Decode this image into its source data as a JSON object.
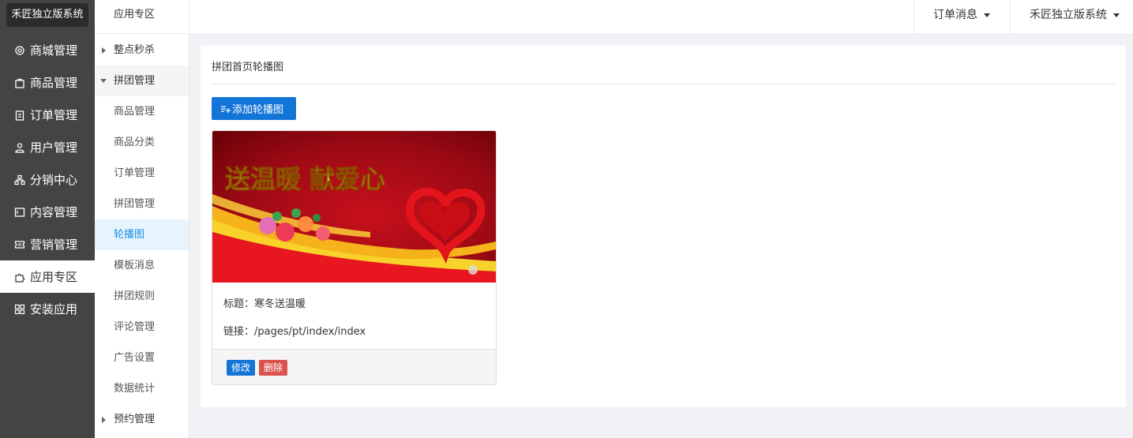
{
  "sidebar": {
    "logo": "禾匠独立版系统",
    "items": [
      {
        "label": "商城管理",
        "icon": "gear-icon"
      },
      {
        "label": "商品管理",
        "icon": "bag-icon"
      },
      {
        "label": "订单管理",
        "icon": "clipboard-icon"
      },
      {
        "label": "用户管理",
        "icon": "user-icon"
      },
      {
        "label": "分销中心",
        "icon": "network-icon"
      },
      {
        "label": "内容管理",
        "icon": "article-icon"
      },
      {
        "label": "营销管理",
        "icon": "ticket-icon"
      },
      {
        "label": "应用专区",
        "icon": "puzzle-icon",
        "active": true
      },
      {
        "label": "安装应用",
        "icon": "apps-icon"
      }
    ]
  },
  "subnav": {
    "header": "应用专区",
    "items": [
      {
        "label": "整点秒杀"
      },
      {
        "label": "拼团管理"
      },
      {
        "label": "商品管理"
      },
      {
        "label": "商品分类"
      },
      {
        "label": "订单管理"
      },
      {
        "label": "拼团管理"
      },
      {
        "label": "轮播图"
      },
      {
        "label": "模板消息"
      },
      {
        "label": "拼团规则"
      },
      {
        "label": "评论管理"
      },
      {
        "label": "广告设置"
      },
      {
        "label": "数据统计"
      },
      {
        "label": "预约管理"
      }
    ]
  },
  "topbar": {
    "order_msg": "订单消息",
    "account": "禾匠独立版系统"
  },
  "main": {
    "title": "拼团首页轮播图",
    "add_button": "添加轮播图",
    "card": {
      "banner_text": "送温暖  献爱心",
      "title_line": "标题：寒冬送温暖",
      "link_line": "链接：/pages/pt/index/index",
      "edit": "修改",
      "delete": "删除"
    }
  },
  "colors": {
    "sidebar_bg": "#444444",
    "primary": "#1475d8",
    "danger": "#d9534f",
    "selected_text": "#1a8fe3"
  }
}
